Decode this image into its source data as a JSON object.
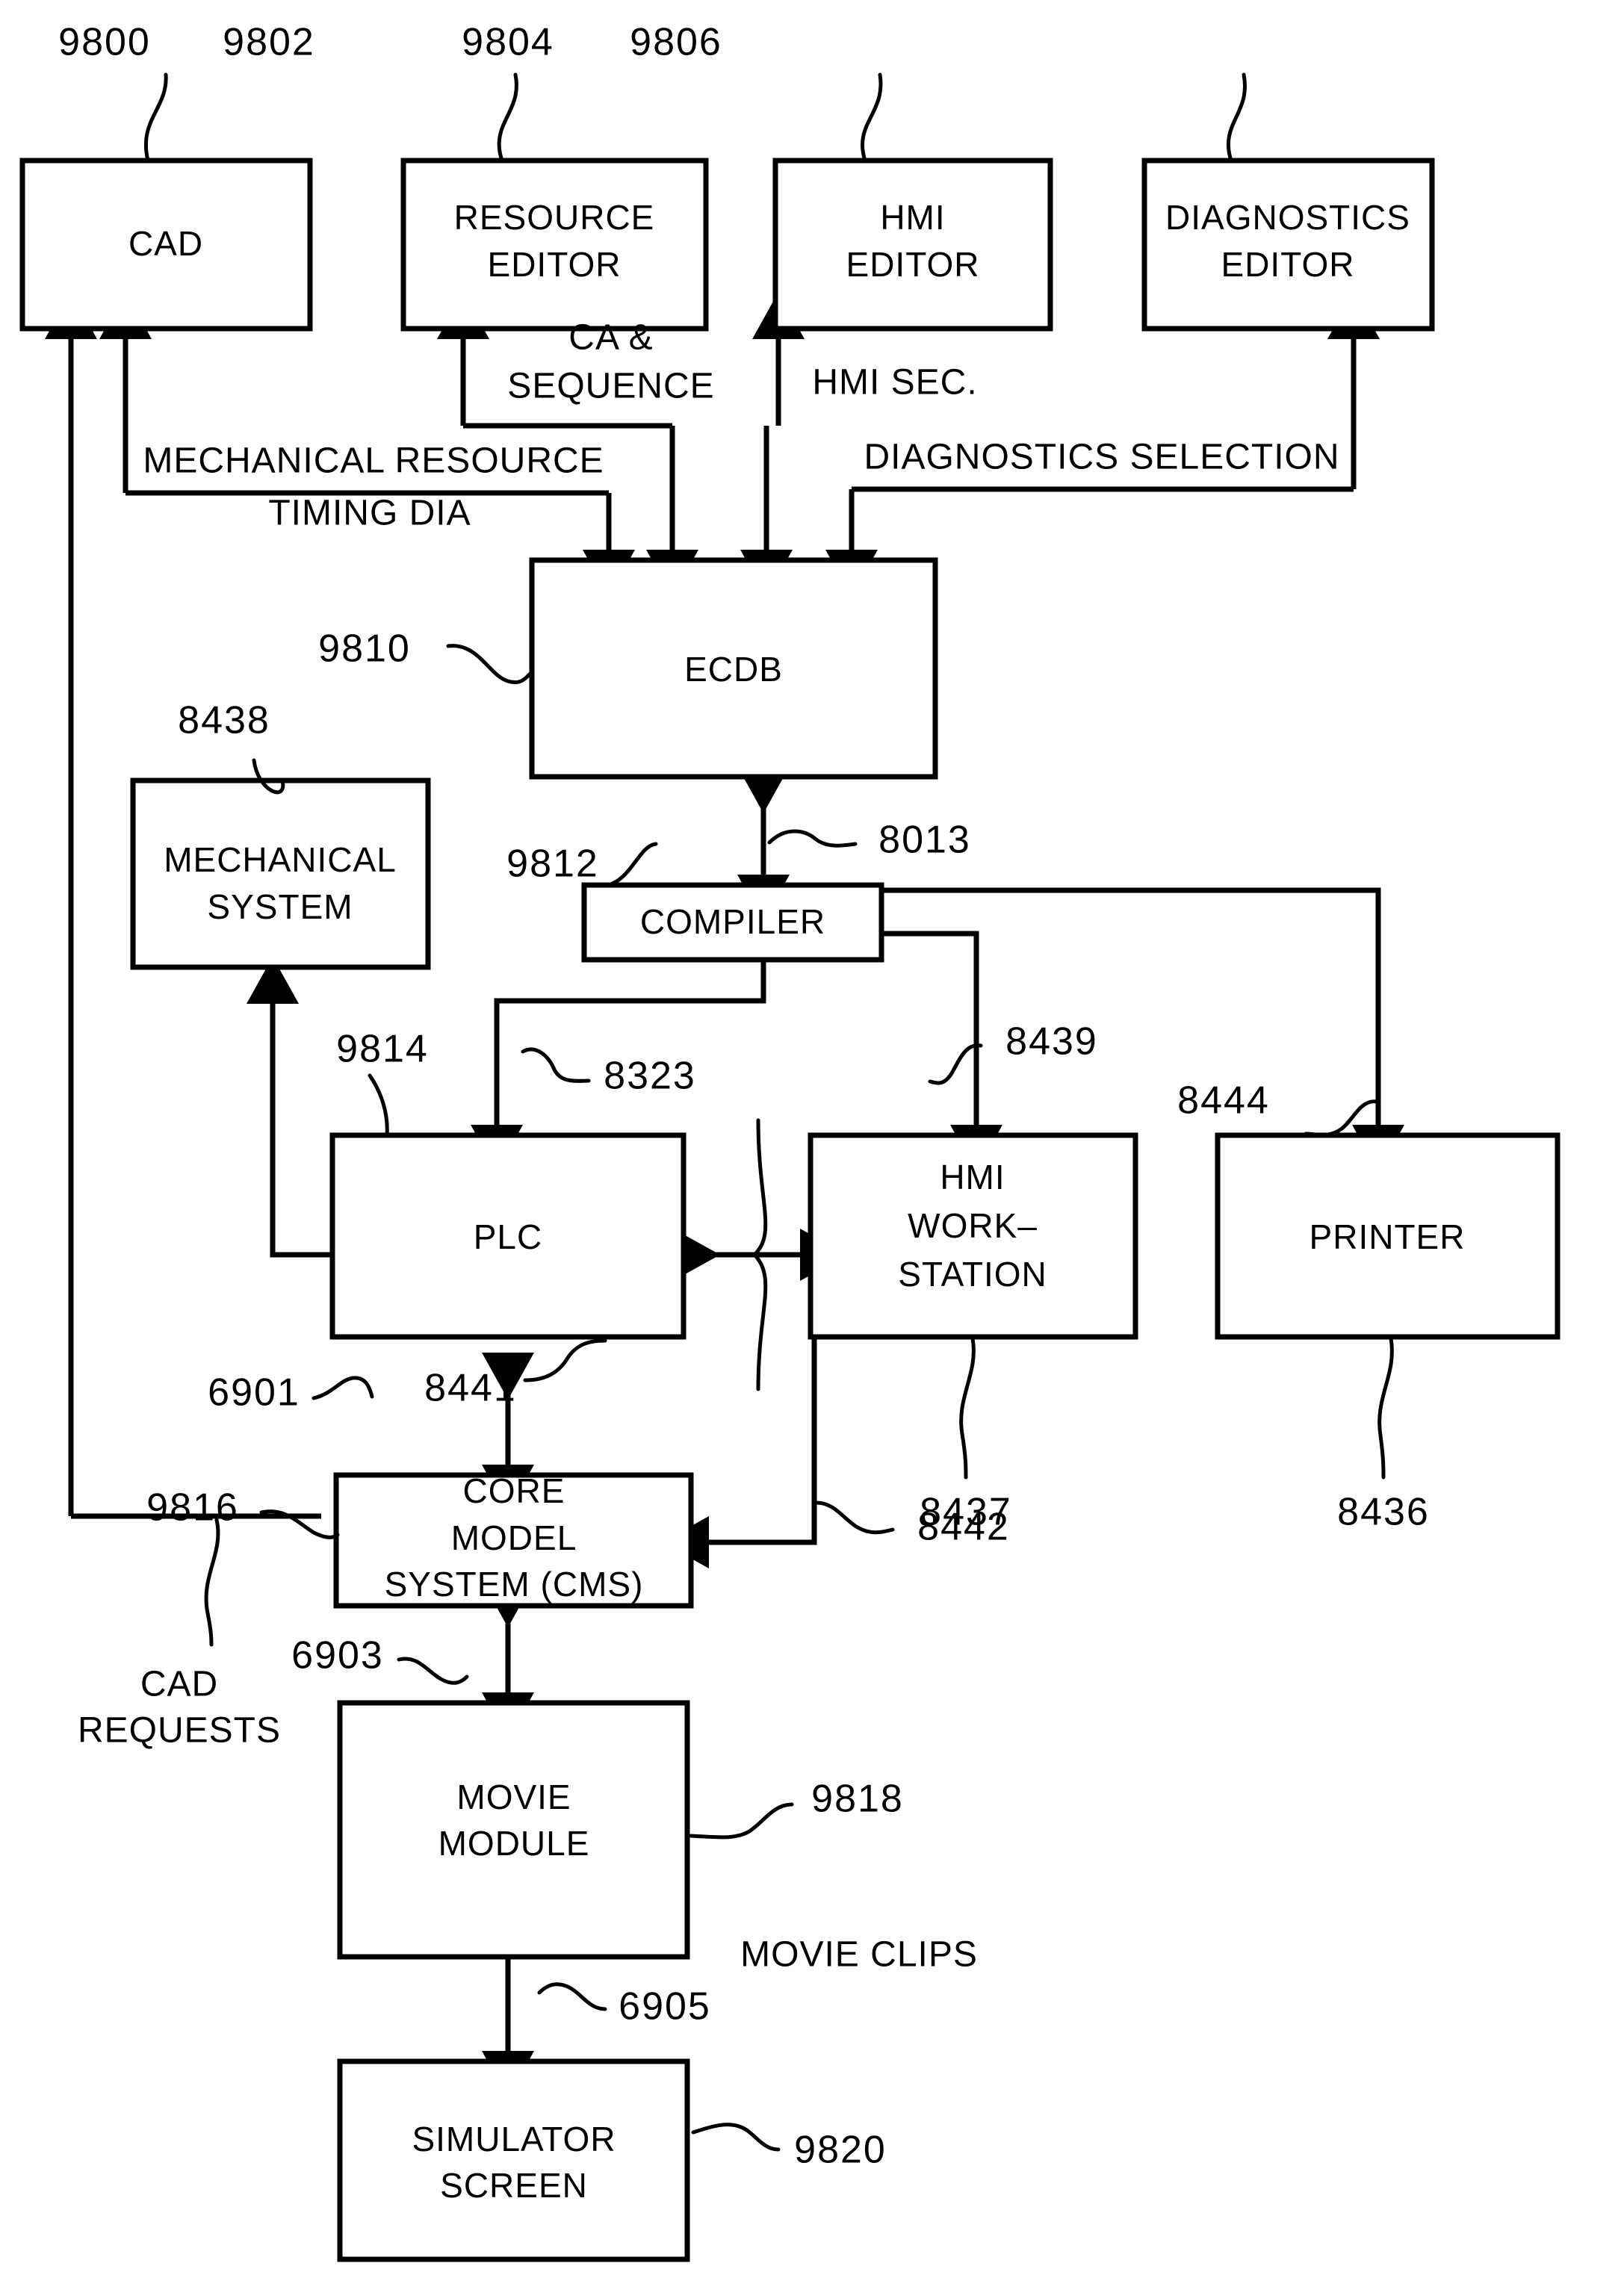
{
  "figure": {
    "type": "patent-block-diagram",
    "background": "#ffffff",
    "stroke": "#000000"
  },
  "blocks": {
    "cad": {
      "label": "CAD",
      "ref": "9800"
    },
    "resource_editor": {
      "line1": "RESOURCE",
      "line2": "EDITOR",
      "ref": "9802"
    },
    "hmi_editor": {
      "line1": "HMI",
      "line2": "EDITOR",
      "ref": "9804"
    },
    "diagnostics_editor": {
      "line1": "DIAGNOSTICS",
      "line2": "EDITOR",
      "ref": "9806"
    },
    "ecdb": {
      "label": "ECDB",
      "ref": "9810"
    },
    "mechanical_system": {
      "line1": "MECHANICAL",
      "line2": "SYSTEM",
      "ref": "8438"
    },
    "compiler": {
      "label": "COMPILER",
      "ref": "9812"
    },
    "plc": {
      "label": "PLC",
      "ref": "9814"
    },
    "hmi_workstation": {
      "line1": "HMI",
      "line2": "WORK–",
      "line3": "STATION",
      "ref": "8437"
    },
    "printer": {
      "label": "PRINTER",
      "ref": "8436"
    },
    "core_model_system": {
      "line1": "CORE",
      "line2": "MODEL",
      "line3": "SYSTEM  (CMS)",
      "ref": "9816"
    },
    "movie_module": {
      "line1": "MOVIE",
      "line2": "MODULE",
      "ref": "9818"
    },
    "simulator_screen": {
      "line1": "SIMULATOR",
      "line2": "SCREEN",
      "ref": "9820"
    }
  },
  "flow_labels": {
    "ca_sequence_line1": "CA &",
    "ca_sequence_line2": "SEQUENCE",
    "hmi_sec": "HMI SEC.",
    "mechanical_resource": "MECHANICAL  RESOURCE",
    "timing_dia": "TIMING DIA",
    "diagnostics_selection": "DIAGNOSTICS  SELECTION",
    "cad_requests_line1": "CAD",
    "cad_requests_line2": "REQUESTS",
    "movie_clips": "MOVIE CLIPS"
  },
  "connector_refs": {
    "ecdb_compiler": "8013",
    "compiler_plc": "8323",
    "compiler_hmi": "8439",
    "compiler_printer": "8444",
    "plc_cms": "6901",
    "plc_hmi_bus": "8441",
    "hmi_cms": "8442",
    "cms_movie": "6903",
    "movie_simulator": "6905"
  }
}
